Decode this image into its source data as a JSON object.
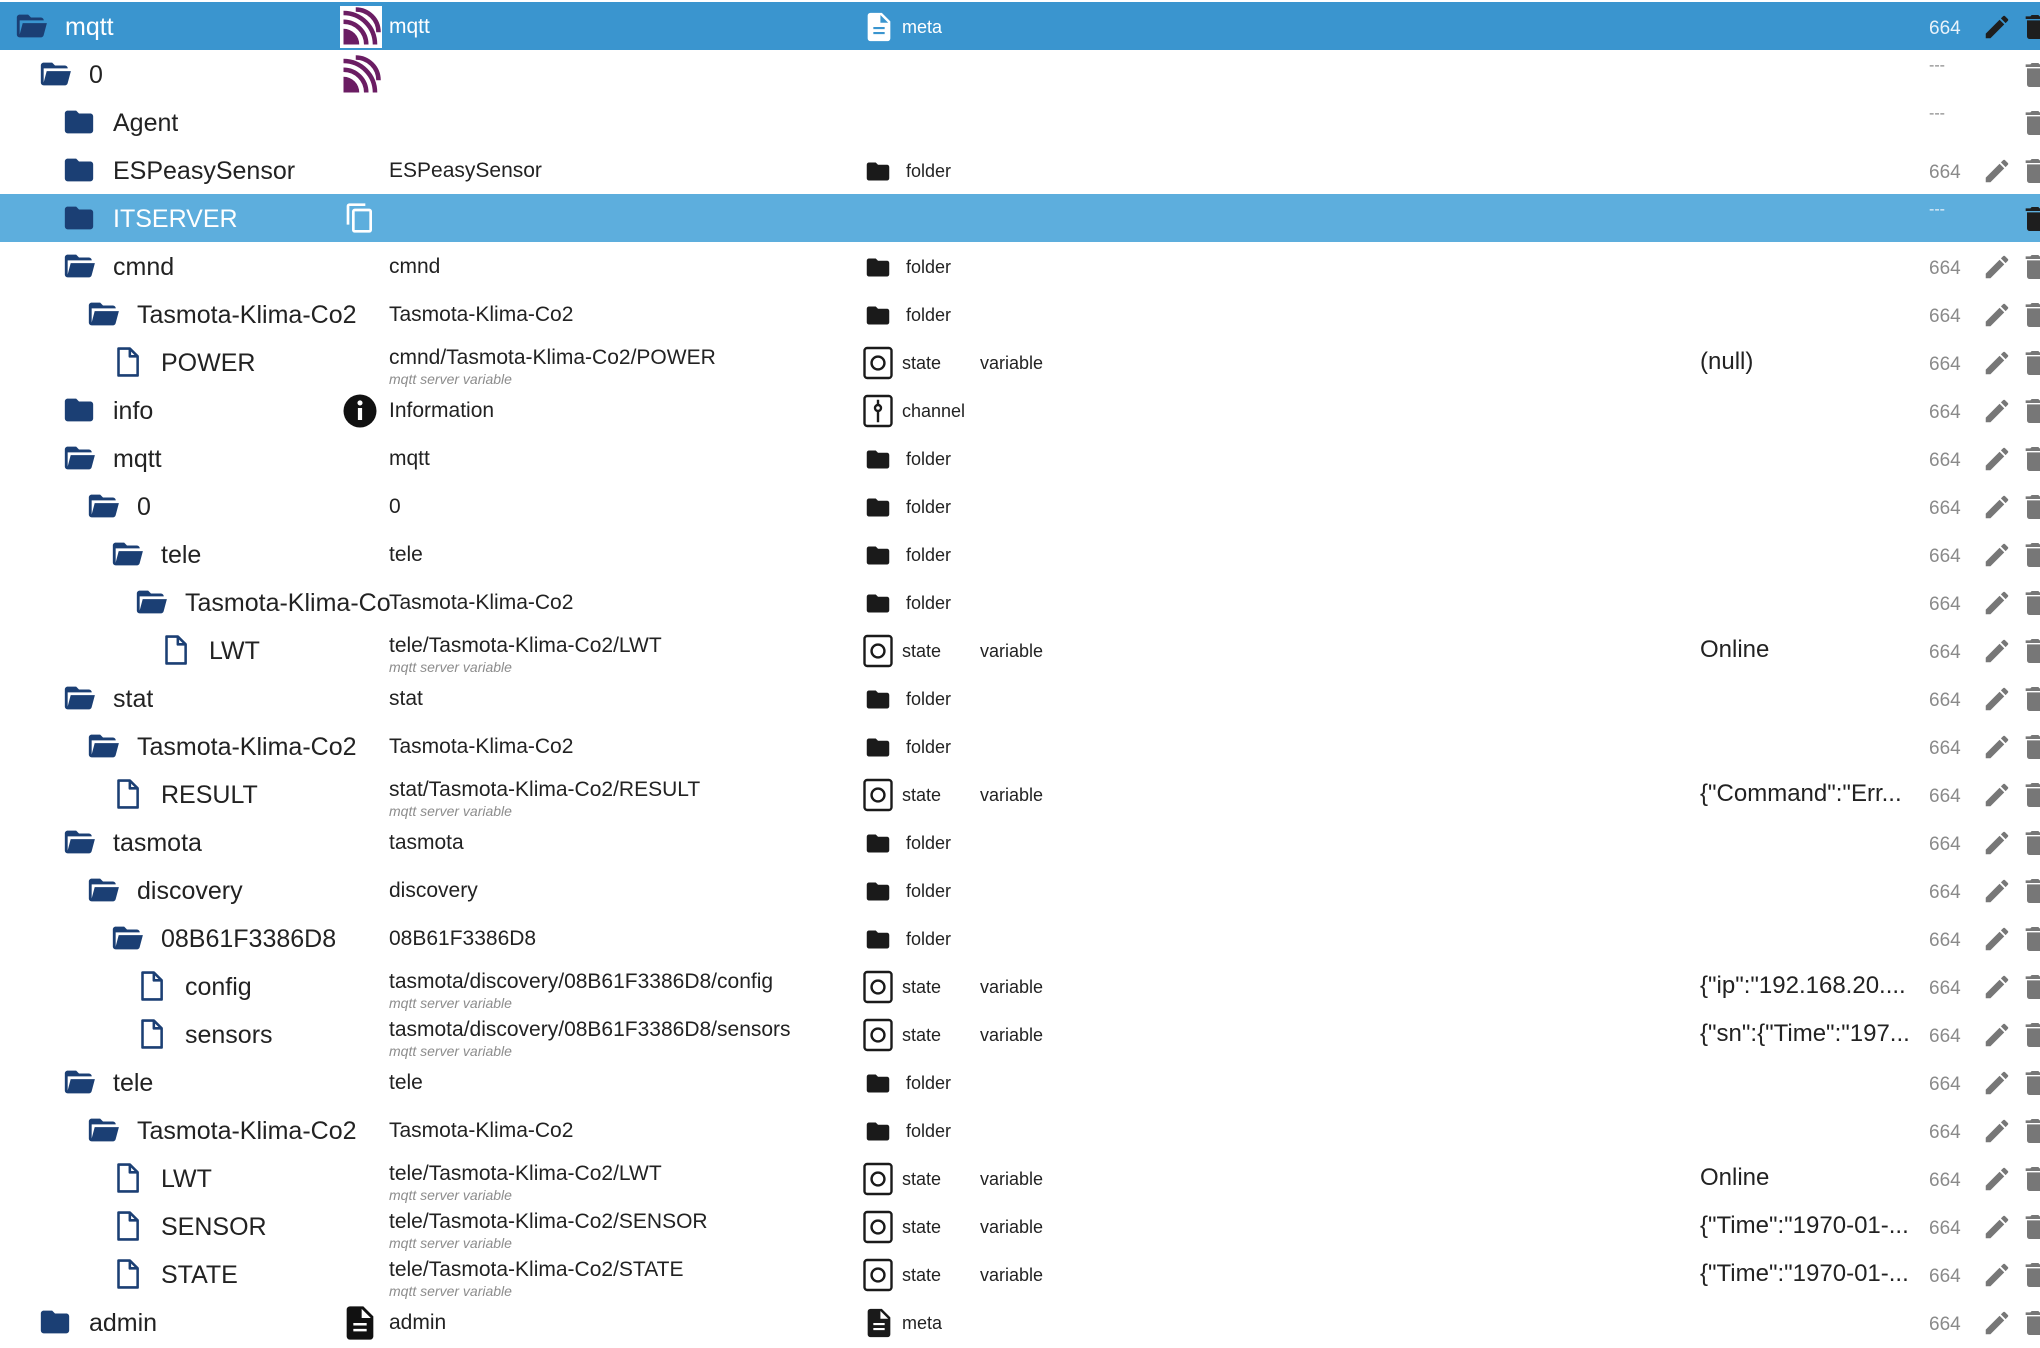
{
  "colors": {
    "selected_row": "#3a95cf",
    "highlight_row": "#5daedd",
    "folder_icon": "#1b3f74",
    "type_icon": "#1a1a1a",
    "mqtt_logo": "#6b1d63",
    "action_icon": "#777777"
  },
  "rows": [
    {
      "name": "mqtt",
      "depth": 0,
      "icon": "folder-open-icon",
      "logo": "mqtt",
      "label": "mqtt",
      "subtitle": "",
      "type_icon": "file-document-icon",
      "type": "meta",
      "role": "",
      "value": "",
      "acl": "664",
      "edit": true,
      "row_state": "selected"
    },
    {
      "name": "0",
      "depth": 1,
      "icon": "folder-open-icon",
      "logo": "mqtt",
      "label": "",
      "subtitle": "",
      "type_icon": "",
      "type": "",
      "role": "",
      "value": "",
      "acl": "---",
      "edit": false,
      "row_state": ""
    },
    {
      "name": "Agent",
      "depth": 2,
      "icon": "folder-icon",
      "logo": "",
      "label": "",
      "subtitle": "",
      "type_icon": "",
      "type": "",
      "role": "",
      "value": "",
      "acl": "---",
      "edit": false,
      "row_state": ""
    },
    {
      "name": "ESPeasySensor",
      "depth": 2,
      "icon": "folder-icon",
      "logo": "",
      "label": "ESPeasySensor",
      "subtitle": "",
      "type_icon": "folder-icon",
      "type": "folder",
      "role": "",
      "value": "",
      "acl": "664",
      "edit": true,
      "row_state": ""
    },
    {
      "name": "ITSERVER",
      "depth": 2,
      "icon": "folder-icon",
      "logo": "copy",
      "label": "",
      "subtitle": "",
      "type_icon": "",
      "type": "",
      "role": "",
      "value": "",
      "acl": "---",
      "edit": false,
      "row_state": "highlight"
    },
    {
      "name": "cmnd",
      "depth": 2,
      "icon": "folder-open-icon",
      "logo": "",
      "label": "cmnd",
      "subtitle": "",
      "type_icon": "folder-icon",
      "type": "folder",
      "role": "",
      "value": "",
      "acl": "664",
      "edit": true,
      "row_state": ""
    },
    {
      "name": "Tasmota-Klima-Co2",
      "depth": 3,
      "icon": "folder-open-icon",
      "logo": "",
      "label": "Tasmota-Klima-Co2",
      "subtitle": "",
      "type_icon": "folder-icon",
      "type": "folder",
      "role": "",
      "value": "",
      "acl": "664",
      "edit": true,
      "row_state": ""
    },
    {
      "name": "POWER",
      "depth": 4,
      "icon": "file-icon",
      "logo": "",
      "label": "cmnd/Tasmota-Klima-Co2/POWER",
      "subtitle": "mqtt server variable",
      "type_icon": "state-icon",
      "type": "state",
      "role": "variable",
      "value": "(null)",
      "acl": "664",
      "edit": true,
      "row_state": ""
    },
    {
      "name": "info",
      "depth": 2,
      "icon": "folder-icon",
      "logo": "info",
      "label": "Information",
      "subtitle": "",
      "type_icon": "channel-icon",
      "type": "channel",
      "role": "",
      "value": "",
      "acl": "664",
      "edit": true,
      "row_state": ""
    },
    {
      "name": "mqtt",
      "depth": 2,
      "icon": "folder-open-icon",
      "logo": "",
      "label": "mqtt",
      "subtitle": "",
      "type_icon": "folder-icon",
      "type": "folder",
      "role": "",
      "value": "",
      "acl": "664",
      "edit": true,
      "row_state": ""
    },
    {
      "name": "0",
      "depth": 3,
      "icon": "folder-open-icon",
      "logo": "",
      "label": "0",
      "subtitle": "",
      "type_icon": "folder-icon",
      "type": "folder",
      "role": "",
      "value": "",
      "acl": "664",
      "edit": true,
      "row_state": ""
    },
    {
      "name": "tele",
      "depth": 4,
      "icon": "folder-open-icon",
      "logo": "",
      "label": "tele",
      "subtitle": "",
      "type_icon": "folder-icon",
      "type": "folder",
      "role": "",
      "value": "",
      "acl": "664",
      "edit": true,
      "row_state": ""
    },
    {
      "name": "Tasmota-Klima-Co",
      "depth": 5,
      "icon": "folder-open-icon",
      "logo": "",
      "label": "Tasmota-Klima-Co2",
      "subtitle": "",
      "type_icon": "folder-icon",
      "type": "folder",
      "role": "",
      "value": "",
      "acl": "664",
      "edit": true,
      "row_state": ""
    },
    {
      "name": "LWT",
      "depth": 6,
      "icon": "file-icon",
      "logo": "",
      "label": "tele/Tasmota-Klima-Co2/LWT",
      "subtitle": "mqtt server variable",
      "type_icon": "state-icon",
      "type": "state",
      "role": "variable",
      "value": "Online",
      "acl": "664",
      "edit": true,
      "row_state": ""
    },
    {
      "name": "stat",
      "depth": 2,
      "icon": "folder-open-icon",
      "logo": "",
      "label": "stat",
      "subtitle": "",
      "type_icon": "folder-icon",
      "type": "folder",
      "role": "",
      "value": "",
      "acl": "664",
      "edit": true,
      "row_state": ""
    },
    {
      "name": "Tasmota-Klima-Co2",
      "depth": 3,
      "icon": "folder-open-icon",
      "logo": "",
      "label": "Tasmota-Klima-Co2",
      "subtitle": "",
      "type_icon": "folder-icon",
      "type": "folder",
      "role": "",
      "value": "",
      "acl": "664",
      "edit": true,
      "row_state": ""
    },
    {
      "name": "RESULT",
      "depth": 4,
      "icon": "file-icon",
      "logo": "",
      "label": "stat/Tasmota-Klima-Co2/RESULT",
      "subtitle": "mqtt server variable",
      "type_icon": "state-icon",
      "type": "state",
      "role": "variable",
      "value": "{\"Command\":\"Err...",
      "acl": "664",
      "edit": true,
      "row_state": ""
    },
    {
      "name": "tasmota",
      "depth": 2,
      "icon": "folder-open-icon",
      "logo": "",
      "label": "tasmota",
      "subtitle": "",
      "type_icon": "folder-icon",
      "type": "folder",
      "role": "",
      "value": "",
      "acl": "664",
      "edit": true,
      "row_state": ""
    },
    {
      "name": "discovery",
      "depth": 3,
      "icon": "folder-open-icon",
      "logo": "",
      "label": "discovery",
      "subtitle": "",
      "type_icon": "folder-icon",
      "type": "folder",
      "role": "",
      "value": "",
      "acl": "664",
      "edit": true,
      "row_state": ""
    },
    {
      "name": "08B61F3386D8",
      "depth": 4,
      "icon": "folder-open-icon",
      "logo": "",
      "label": "08B61F3386D8",
      "subtitle": "",
      "type_icon": "folder-icon",
      "type": "folder",
      "role": "",
      "value": "",
      "acl": "664",
      "edit": true,
      "row_state": ""
    },
    {
      "name": "config",
      "depth": 5,
      "icon": "file-icon",
      "logo": "",
      "label": "tasmota/discovery/08B61F3386D8/config",
      "subtitle": "mqtt server variable",
      "type_icon": "state-icon",
      "type": "state",
      "role": "variable",
      "value": "{\"ip\":\"192.168.20....",
      "acl": "664",
      "edit": true,
      "row_state": ""
    },
    {
      "name": "sensors",
      "depth": 5,
      "icon": "file-icon",
      "logo": "",
      "label": "tasmota/discovery/08B61F3386D8/sensors",
      "subtitle": "mqtt server variable",
      "type_icon": "state-icon",
      "type": "state",
      "role": "variable",
      "value": "{\"sn\":{\"Time\":\"197...",
      "acl": "664",
      "edit": true,
      "row_state": ""
    },
    {
      "name": "tele",
      "depth": 2,
      "icon": "folder-open-icon",
      "logo": "",
      "label": "tele",
      "subtitle": "",
      "type_icon": "folder-icon",
      "type": "folder",
      "role": "",
      "value": "",
      "acl": "664",
      "edit": true,
      "row_state": ""
    },
    {
      "name": "Tasmota-Klima-Co2",
      "depth": 3,
      "icon": "folder-open-icon",
      "logo": "",
      "label": "Tasmota-Klima-Co2",
      "subtitle": "",
      "type_icon": "folder-icon",
      "type": "folder",
      "role": "",
      "value": "",
      "acl": "664",
      "edit": true,
      "row_state": ""
    },
    {
      "name": "LWT",
      "depth": 4,
      "icon": "file-icon",
      "logo": "",
      "label": "tele/Tasmota-Klima-Co2/LWT",
      "subtitle": "mqtt server variable",
      "type_icon": "state-icon",
      "type": "state",
      "role": "variable",
      "value": "Online",
      "acl": "664",
      "edit": true,
      "row_state": ""
    },
    {
      "name": "SENSOR",
      "depth": 4,
      "icon": "file-icon",
      "logo": "",
      "label": "tele/Tasmota-Klima-Co2/SENSOR",
      "subtitle": "mqtt server variable",
      "type_icon": "state-icon",
      "type": "state",
      "role": "variable",
      "value": "{\"Time\":\"1970-01-...",
      "acl": "664",
      "edit": true,
      "row_state": ""
    },
    {
      "name": "STATE",
      "depth": 4,
      "icon": "file-icon",
      "logo": "",
      "label": "tele/Tasmota-Klima-Co2/STATE",
      "subtitle": "mqtt server variable",
      "type_icon": "state-icon",
      "type": "state",
      "role": "variable",
      "value": "{\"Time\":\"1970-01-...",
      "acl": "664",
      "edit": true,
      "row_state": ""
    },
    {
      "name": "admin",
      "depth": 1,
      "icon": "folder-icon",
      "logo": "doc",
      "label": "admin",
      "subtitle": "",
      "type_icon": "file-document-icon",
      "type": "meta",
      "role": "",
      "value": "",
      "acl": "664",
      "edit": true,
      "row_state": ""
    }
  ]
}
